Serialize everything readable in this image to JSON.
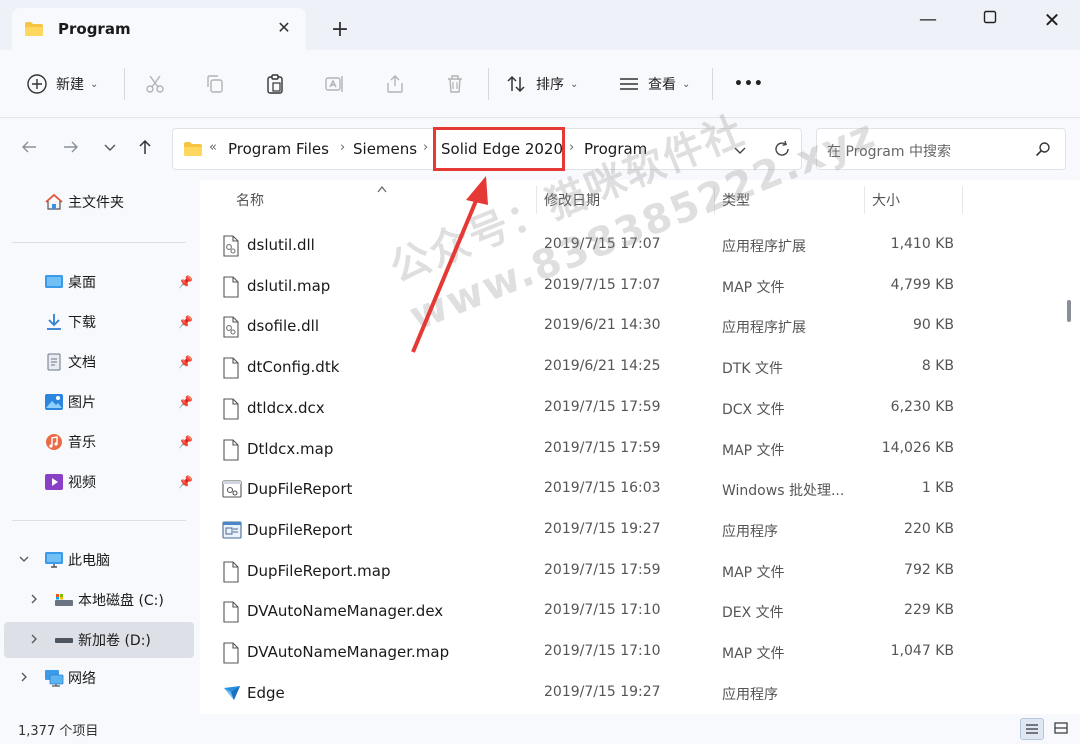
{
  "window": {
    "tab_title": "Program",
    "close_glyph": "✕",
    "new_tab_glyph": "+",
    "minimize_glyph": "—",
    "maximize_glyph": "☐",
    "window_close_glyph": "✕"
  },
  "toolbar": {
    "new_label": "新建",
    "sort_label": "排序",
    "view_label": "查看",
    "more_glyph": "•••",
    "caret": "⌄"
  },
  "address": {
    "crumbs": [
      "Program Files",
      "Siemens",
      "Solid Edge 2020",
      "Program"
    ],
    "overflow_glyph": "«",
    "separator": "›",
    "search_placeholder": "在 Program 中搜索",
    "highlight_color": "#e53935"
  },
  "sidebar": {
    "home": "主文件夹",
    "quick": [
      "桌面",
      "下载",
      "文档",
      "图片",
      "音乐",
      "视频"
    ],
    "this_pc": "此电脑",
    "drive_c": "本地磁盘 (C:)",
    "drive_d": "新加卷 (D:)",
    "network": "网络"
  },
  "columns": {
    "name": "名称",
    "date": "修改日期",
    "type": "类型",
    "size": "大小"
  },
  "files": [
    {
      "name": "dslutil.dll",
      "date": "2019/7/15 17:07",
      "type": "应用程序扩展",
      "size": "1,410 KB",
      "icon": "dll-icon"
    },
    {
      "name": "dslutil.map",
      "date": "2019/7/15 17:07",
      "type": "MAP 文件",
      "size": "4,799 KB",
      "icon": "file-icon"
    },
    {
      "name": "dsofile.dll",
      "date": "2019/6/21 14:30",
      "type": "应用程序扩展",
      "size": "90 KB",
      "icon": "dll-icon"
    },
    {
      "name": "dtConfig.dtk",
      "date": "2019/6/21 14:25",
      "type": "DTK 文件",
      "size": "8 KB",
      "icon": "file-icon"
    },
    {
      "name": "dtldcx.dcx",
      "date": "2019/7/15 17:59",
      "type": "DCX 文件",
      "size": "6,230 KB",
      "icon": "file-icon"
    },
    {
      "name": "Dtldcx.map",
      "date": "2019/7/15 17:59",
      "type": "MAP 文件",
      "size": "14,026 KB",
      "icon": "file-icon"
    },
    {
      "name": "DupFileReport",
      "date": "2019/7/15 16:03",
      "type": "Windows 批处理...",
      "size": "1 KB",
      "icon": "batch-icon"
    },
    {
      "name": "DupFileReport",
      "date": "2019/7/15 19:27",
      "type": "应用程序",
      "size": "220 KB",
      "icon": "exe-icon"
    },
    {
      "name": "DupFileReport.map",
      "date": "2019/7/15 17:59",
      "type": "MAP 文件",
      "size": "792 KB",
      "icon": "file-icon"
    },
    {
      "name": "DVAutoNameManager.dex",
      "date": "2019/7/15 17:10",
      "type": "DEX 文件",
      "size": "229 KB",
      "icon": "file-icon"
    },
    {
      "name": "DVAutoNameManager.map",
      "date": "2019/7/15 17:10",
      "type": "MAP 文件",
      "size": "1,047 KB",
      "icon": "file-icon"
    },
    {
      "name": "Edge",
      "date": "2019/7/15 19:27",
      "type": "应用程序",
      "size": "",
      "icon": "edge-app-icon"
    }
  ],
  "status": {
    "count": "1,377 个项目"
  },
  "watermark": {
    "line1": "公众号：猫咪软件社",
    "line2": "www.838385222.xyz"
  }
}
